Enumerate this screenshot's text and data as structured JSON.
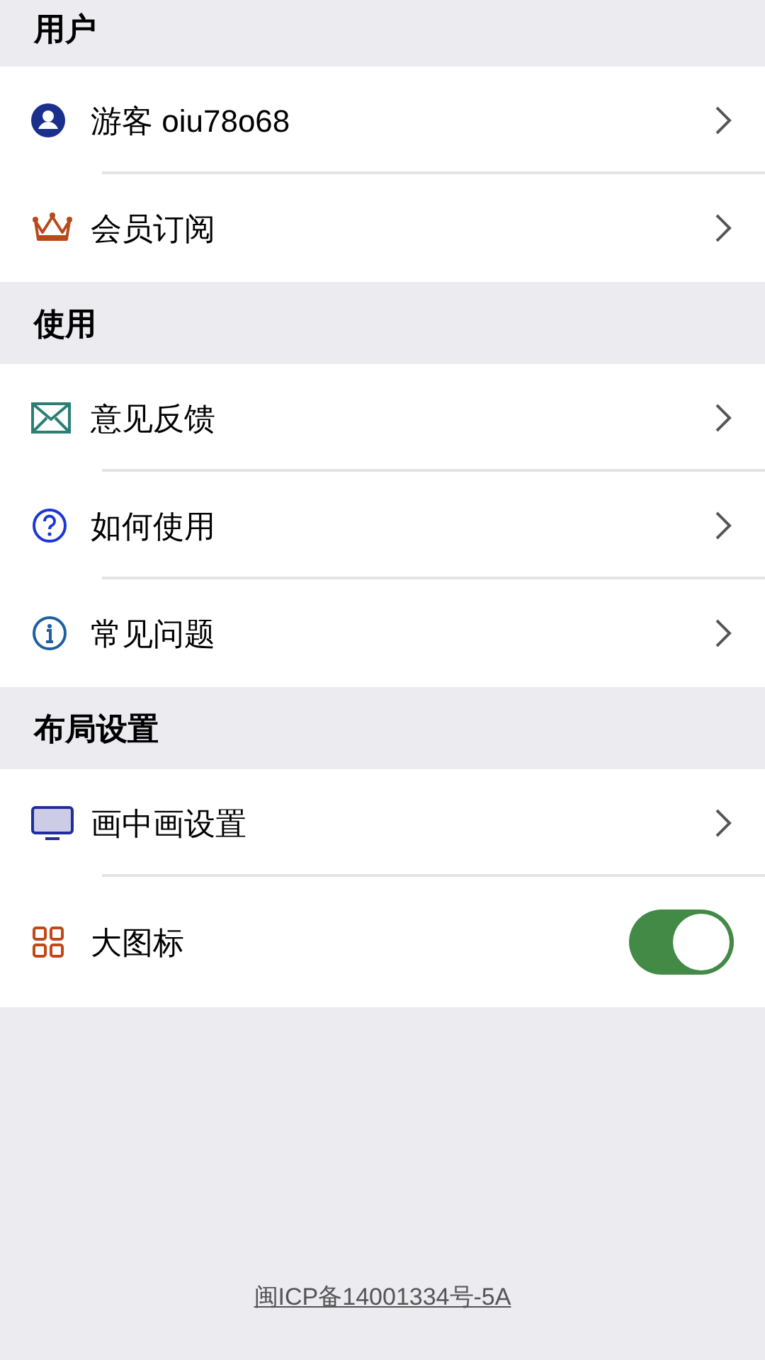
{
  "sections": [
    {
      "title": "用户",
      "items": [
        {
          "kind": "link",
          "label": "游客 oiu78o68"
        },
        {
          "kind": "link",
          "label": "会员订阅"
        }
      ]
    },
    {
      "title": "使用",
      "items": [
        {
          "kind": "link",
          "label": "意见反馈"
        },
        {
          "kind": "link",
          "label": "如何使用"
        },
        {
          "kind": "link",
          "label": "常见问题"
        }
      ]
    },
    {
      "title": "布局设置",
      "items": [
        {
          "kind": "link",
          "label": "画中画设置"
        },
        {
          "kind": "toggle",
          "label": "大图标",
          "on": true
        }
      ]
    }
  ],
  "footer": {
    "link": "闽ICP备14001334号-5A"
  }
}
